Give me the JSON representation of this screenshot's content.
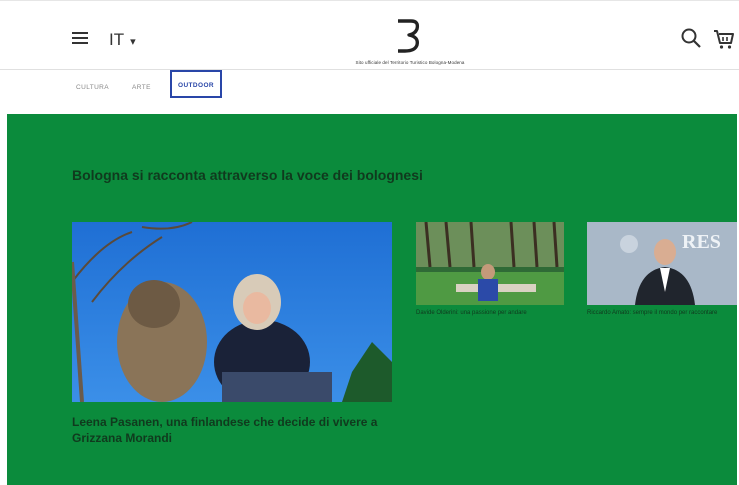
{
  "header": {
    "language": "IT",
    "tagline": "Sito ufficiale del Territorio Turistico Bologna-Modena",
    "brand": "B"
  },
  "tabs": [
    {
      "label": "CULTURA",
      "active": false
    },
    {
      "label": "ARTE",
      "active": false
    },
    {
      "label": "OUTDOOR",
      "active": true
    }
  ],
  "section": {
    "title": "Bologna si racconta attraverso la voce dei bolognesi",
    "background": "#0b8b3c"
  },
  "cards": [
    {
      "title": "Leena Pasanen, una finlandese che decide di vivere a Grizzana Morandi"
    },
    {
      "title": "Davide Olderini: una passione per andare"
    },
    {
      "title": "Riccardo Amato: sempre il mondo per raccontare"
    }
  ],
  "icons": {
    "menu": "hamburger-icon",
    "search": "search-icon",
    "cart": "cart-icon",
    "caret": "chevron-down-icon"
  }
}
